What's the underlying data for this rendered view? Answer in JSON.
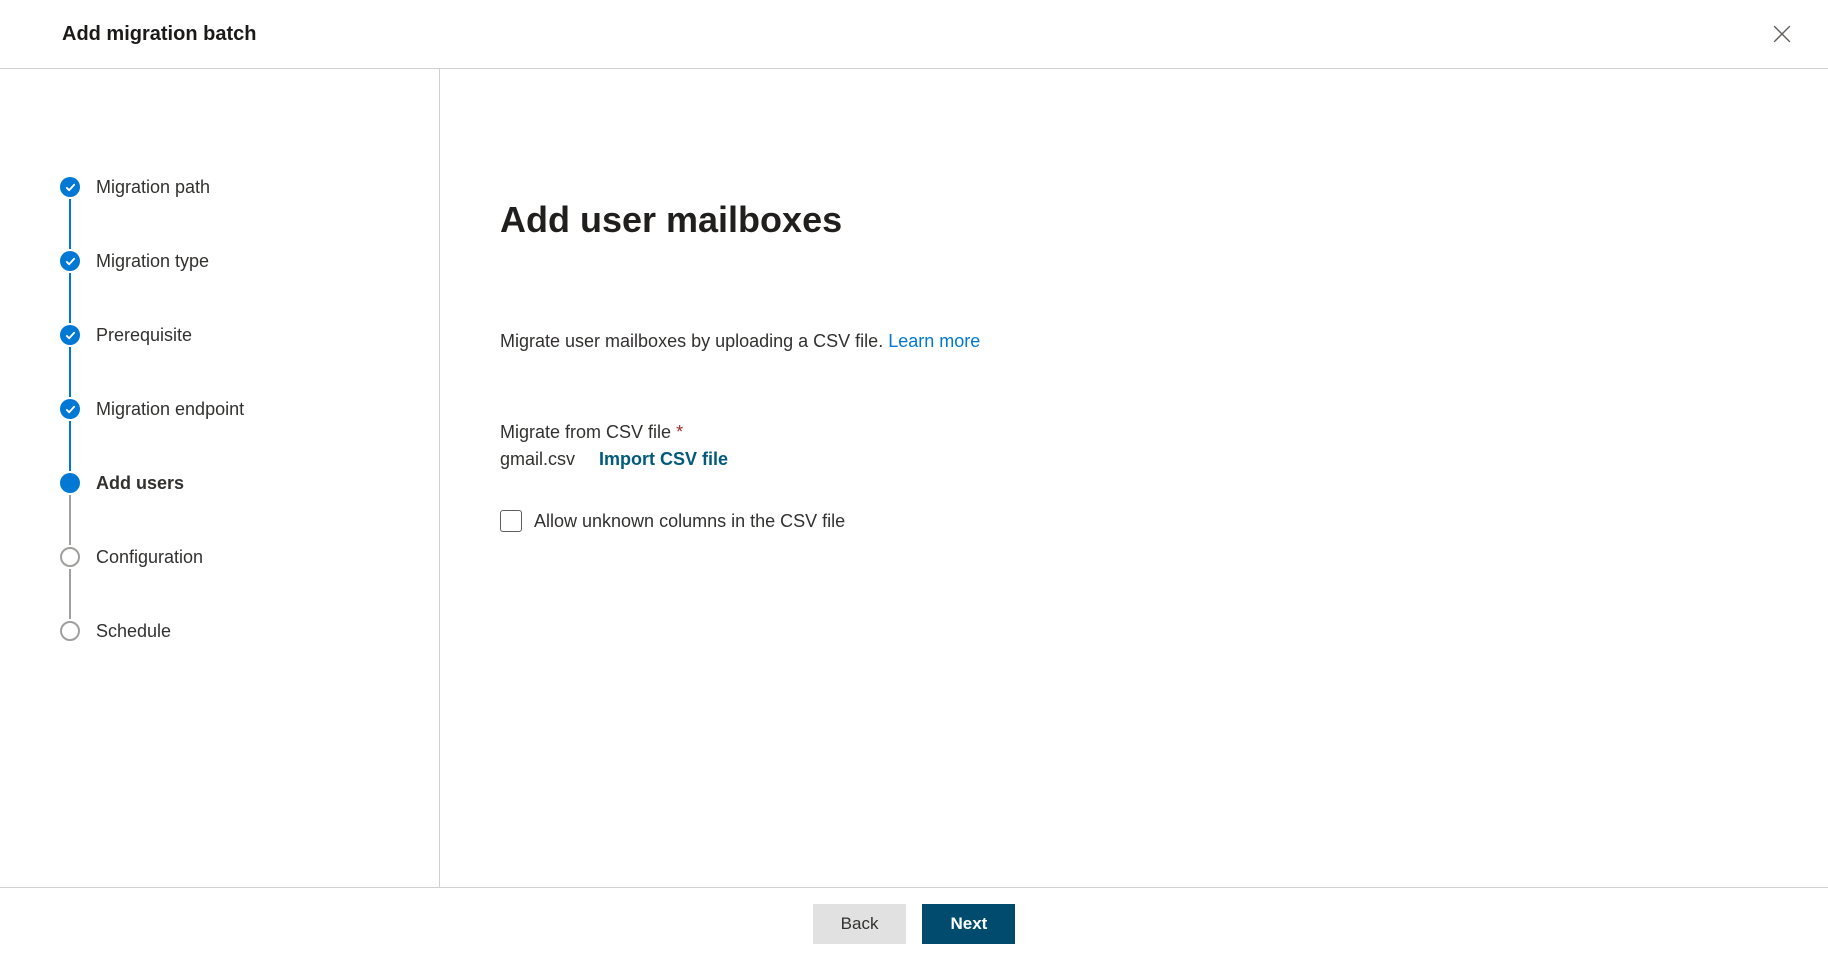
{
  "header": {
    "title": "Add migration batch"
  },
  "steps": [
    {
      "label": "Migration path",
      "state": "done"
    },
    {
      "label": "Migration type",
      "state": "done"
    },
    {
      "label": "Prerequisite",
      "state": "done"
    },
    {
      "label": "Migration endpoint",
      "state": "done"
    },
    {
      "label": "Add users",
      "state": "current"
    },
    {
      "label": "Configuration",
      "state": "pending"
    },
    {
      "label": "Schedule",
      "state": "pending"
    }
  ],
  "main": {
    "title": "Add user mailboxes",
    "description": "Migrate user mailboxes by uploading a CSV file. ",
    "learn_more": "Learn more",
    "csv_label": "Migrate from CSV file",
    "file_name": "gmail.csv",
    "import_label": "Import CSV file",
    "checkbox_label": "Allow unknown columns in the CSV file"
  },
  "footer": {
    "back": "Back",
    "next": "Next"
  }
}
